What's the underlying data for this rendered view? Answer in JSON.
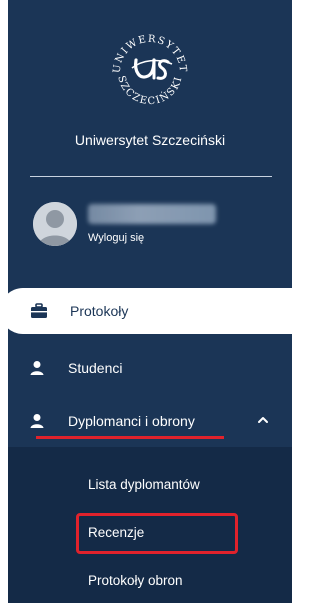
{
  "university": {
    "logo_text_top": "UNIWERSYTET",
    "logo_text_bottom": "SZCZECIŃSKI",
    "name": "Uniwersytet Szczeciński"
  },
  "user": {
    "logout_label": "Wyloguj się"
  },
  "nav": {
    "items": [
      {
        "label": "Protokoły",
        "icon": "briefcase-icon",
        "active": true
      },
      {
        "label": "Studenci",
        "icon": "user-icon",
        "active": false
      },
      {
        "label": "Dyplomanci i obrony",
        "icon": "user-icon",
        "active": false,
        "expanded": true
      }
    ],
    "submenu": [
      {
        "label": "Lista dyplomantów"
      },
      {
        "label": "Recenzje",
        "highlighted": true
      },
      {
        "label": "Protokoły obron"
      }
    ]
  },
  "colors": {
    "sidebar_bg": "#1b3556",
    "submenu_bg": "#142a47",
    "active_bg": "#ffffff",
    "highlight": "#e0222c",
    "text": "#ffffff"
  }
}
